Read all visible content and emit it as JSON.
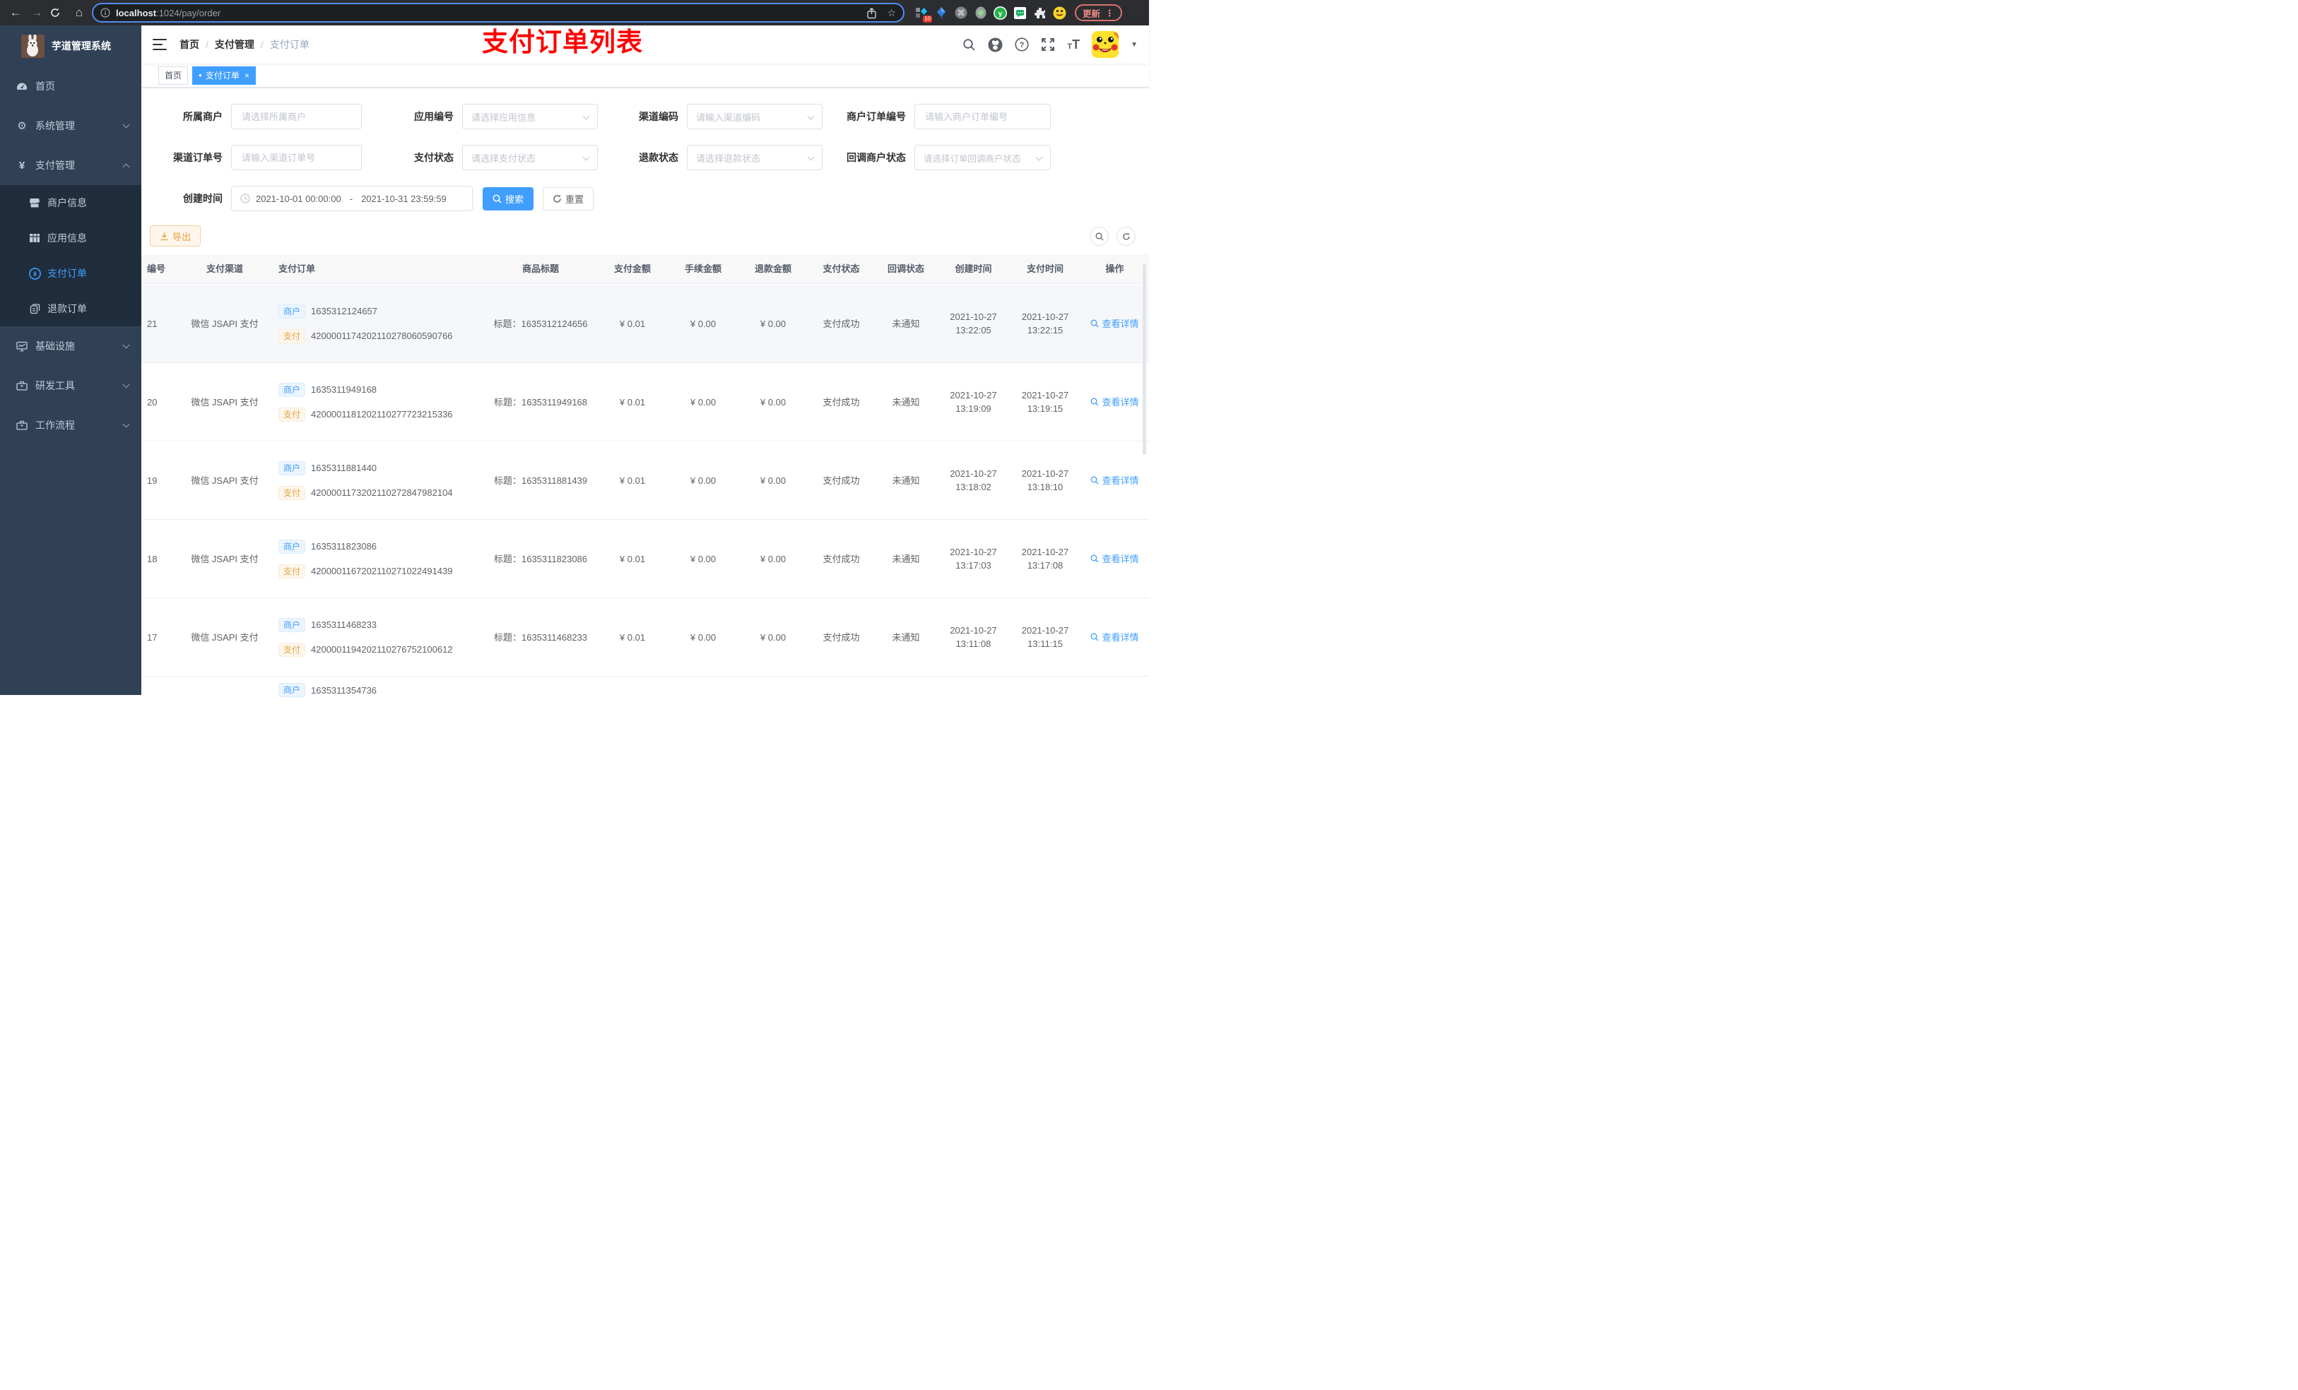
{
  "browser": {
    "url_host": "localhost",
    "url_rest": ":1024/pay/order",
    "ext_badge": "10",
    "update_label": "更新"
  },
  "icons": {
    "back": "←",
    "forward": "→",
    "home": "⌂",
    "star": "☆",
    "command": "⌘",
    "dots": "⋮",
    "caret": "▼",
    "close": "×",
    "dot": "●",
    "yen": "¥",
    "gear": "⚙",
    "question": "?",
    "font_small": "T",
    "font_large": "T",
    "breadcrumb_sep": "/"
  },
  "sidebar": {
    "app_title": "芋道管理系统",
    "items": [
      {
        "label": "首页"
      },
      {
        "label": "系统管理"
      },
      {
        "label": "支付管理"
      },
      {
        "label": "基础设施"
      },
      {
        "label": "研发工具"
      },
      {
        "label": "工作流程"
      }
    ],
    "pay_children": [
      {
        "label": "商户信息"
      },
      {
        "label": "应用信息"
      },
      {
        "label": "支付订单"
      },
      {
        "label": "退款订单"
      }
    ]
  },
  "header": {
    "breadcrumb": [
      "首页",
      "支付管理",
      "支付订单"
    ],
    "annotation": "支付订单列表"
  },
  "tabs": [
    {
      "label": "首页"
    },
    {
      "label": "支付订单"
    }
  ],
  "filters": {
    "merchant": {
      "label": "所属商户",
      "placeholder": "请选择所属商户"
    },
    "app": {
      "label": "应用编号",
      "placeholder": "请选择应用信息"
    },
    "channel_code": {
      "label": "渠道编码",
      "placeholder": "请输入渠道编码"
    },
    "merchant_order_no": {
      "label": "商户订单编号",
      "placeholder": "请输入商户订单编号"
    },
    "channel_order_no": {
      "label": "渠道订单号",
      "placeholder": "请输入渠道订单号"
    },
    "pay_status": {
      "label": "支付状态",
      "placeholder": "请选择支付状态"
    },
    "refund_status": {
      "label": "退款状态",
      "placeholder": "请选择退款状态"
    },
    "notify_status": {
      "label": "回调商户状态",
      "placeholder": "请选择订单回调商户状态"
    },
    "create_time": {
      "label": "创建时间",
      "start": "2021-10-01 00:00:00",
      "separator": "-",
      "end": "2021-10-31 23:59:59"
    },
    "search_label": "搜索",
    "reset_label": "重置"
  },
  "toolbar": {
    "export_label": "导出"
  },
  "table": {
    "headers": [
      "编号",
      "支付渠道",
      "支付订单",
      "商品标题",
      "支付金额",
      "手续金额",
      "退款金额",
      "支付状态",
      "回调状态",
      "创建时间",
      "支付时间",
      "操作"
    ],
    "badge_merchant": "商户",
    "badge_pay": "支付",
    "action_label": "查看详情",
    "rows": [
      {
        "id": "21",
        "channel": "微信 JSAPI 支付",
        "merchant_no": "1635312124657",
        "pay_no": "4200001174202110278060590766",
        "title": "标题：1635312124656",
        "pay_amount": "¥ 0.01",
        "fee_amount": "¥ 0.00",
        "refund_amount": "¥ 0.00",
        "pay_status": "支付成功",
        "notify_status": "未通知",
        "created_date": "2021-10-27",
        "created_clock": "13:22:05",
        "paid_date": "2021-10-27",
        "paid_clock": "13:22:15"
      },
      {
        "id": "20",
        "channel": "微信 JSAPI 支付",
        "merchant_no": "1635311949168",
        "pay_no": "4200001181202110277723215336",
        "title": "标题：1635311949168",
        "pay_amount": "¥ 0.01",
        "fee_amount": "¥ 0.00",
        "refund_amount": "¥ 0.00",
        "pay_status": "支付成功",
        "notify_status": "未通知",
        "created_date": "2021-10-27",
        "created_clock": "13:19:09",
        "paid_date": "2021-10-27",
        "paid_clock": "13:19:15"
      },
      {
        "id": "19",
        "channel": "微信 JSAPI 支付",
        "merchant_no": "1635311881440",
        "pay_no": "4200001173202110272847982104",
        "title": "标题：1635311881439",
        "pay_amount": "¥ 0.01",
        "fee_amount": "¥ 0.00",
        "refund_amount": "¥ 0.00",
        "pay_status": "支付成功",
        "notify_status": "未通知",
        "created_date": "2021-10-27",
        "created_clock": "13:18:02",
        "paid_date": "2021-10-27",
        "paid_clock": "13:18:10"
      },
      {
        "id": "18",
        "channel": "微信 JSAPI 支付",
        "merchant_no": "1635311823086",
        "pay_no": "4200001167202110271022491439",
        "title": "标题：1635311823086",
        "pay_amount": "¥ 0.01",
        "fee_amount": "¥ 0.00",
        "refund_amount": "¥ 0.00",
        "pay_status": "支付成功",
        "notify_status": "未通知",
        "created_date": "2021-10-27",
        "created_clock": "13:17:03",
        "paid_date": "2021-10-27",
        "paid_clock": "13:17:08"
      },
      {
        "id": "17",
        "channel": "微信 JSAPI 支付",
        "merchant_no": "1635311468233",
        "pay_no": "4200001194202110276752100612",
        "title": "标题：1635311468233",
        "pay_amount": "¥ 0.01",
        "fee_amount": "¥ 0.00",
        "refund_amount": "¥ 0.00",
        "pay_status": "支付成功",
        "notify_status": "未通知",
        "created_date": "2021-10-27",
        "created_clock": "13:11:08",
        "paid_date": "2021-10-27",
        "paid_clock": "13:11:15"
      },
      {
        "merchant_no": "1635311354736"
      }
    ]
  }
}
